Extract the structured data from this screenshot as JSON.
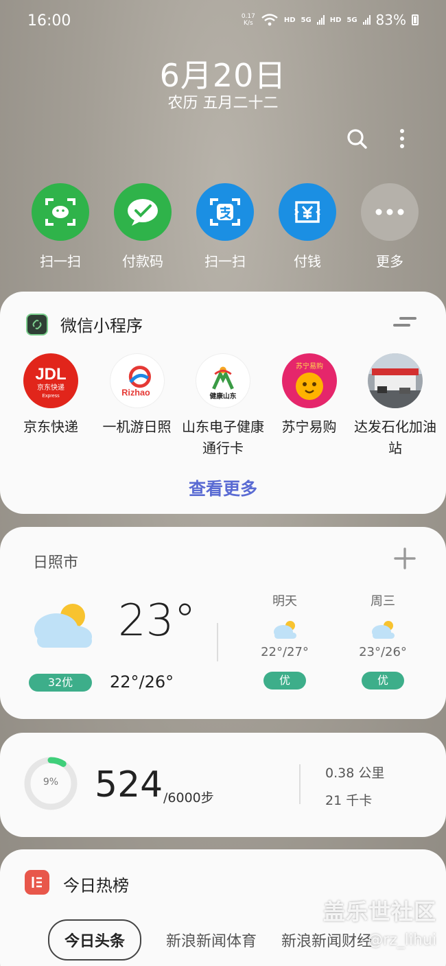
{
  "status": {
    "time": "16:00",
    "net_speed_value": "0.17",
    "net_speed_unit": "K/s",
    "hd1": "HD",
    "net1": "5G",
    "hd2": "HD",
    "net2": "5G",
    "battery": "83%"
  },
  "date": {
    "main": "6月20日",
    "lunar": "农历 五月二十二"
  },
  "quick_actions": [
    {
      "label": "扫一扫",
      "icon": "wechat-scan-icon",
      "color": "#2fb34a"
    },
    {
      "label": "付款码",
      "icon": "wechat-pay-icon",
      "color": "#2fb34a"
    },
    {
      "label": "扫一扫",
      "icon": "alipay-scan-icon",
      "color": "#1b8fe3"
    },
    {
      "label": "付钱",
      "icon": "alipay-pay-icon",
      "color": "#1b8fe3"
    },
    {
      "label": "更多",
      "icon": "more-icon",
      "color": "#b5b1aa"
    }
  ],
  "mini_programs": {
    "title": "微信小程序",
    "apps": [
      {
        "label": "京东快递",
        "icon": "jdl-logo-icon",
        "logo_text": "JDL",
        "logo_sub": "京东快递",
        "logo_sub2": "Express"
      },
      {
        "label": "一机游日照",
        "icon": "rizhao-logo-icon",
        "logo_text": "Rizhao"
      },
      {
        "label": "山东电子健康通行卡",
        "icon": "health-shandong-logo-icon",
        "logo_text": "健康山东"
      },
      {
        "label": "苏宁易购",
        "icon": "suning-logo-icon",
        "logo_text": "苏宁易购"
      },
      {
        "label": "达发石化加油站",
        "icon": "gas-station-photo-icon"
      }
    ],
    "see_more": "查看更多"
  },
  "weather": {
    "city": "日照市",
    "temp": "23°",
    "aqi": "32优",
    "range": "22°/26°",
    "forecast": [
      {
        "day": "明天",
        "range": "22°/27°",
        "quality": "优"
      },
      {
        "day": "周三",
        "range": "23°/26°",
        "quality": "优"
      }
    ]
  },
  "steps": {
    "percent_label": "9%",
    "progress": 0.09,
    "count": "524",
    "goal": "/6000步",
    "distance": "0.38 公里",
    "calories": "21 千卡"
  },
  "hot": {
    "title": "今日热榜",
    "tabs": [
      "今日头条",
      "新浪新闻体育",
      "新浪新闻财经"
    ]
  },
  "watermark": {
    "line1": "盖乐世社区",
    "line2": "@rz_lihui"
  },
  "colors": {
    "accent_link": "#5a6bd3",
    "quality_green": "#3dae8a",
    "hot_red": "#e8574b",
    "ring_green": "#3fcf7a"
  }
}
